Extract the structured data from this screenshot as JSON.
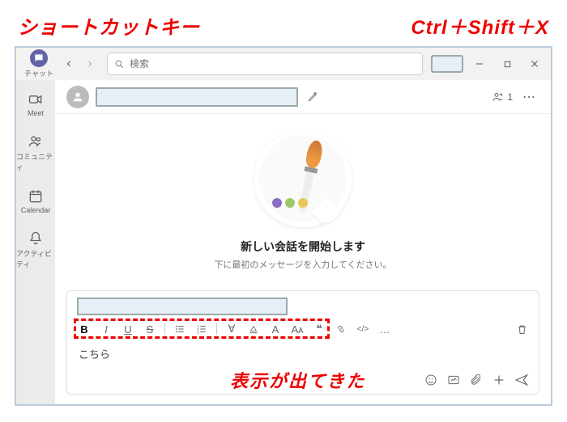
{
  "annotations": {
    "top_left": "ショートカットキー",
    "top_right": "Ctrl＋Shift＋X",
    "middle": "表示が出てきた"
  },
  "titlebar": {
    "app_label": "チャット",
    "search_placeholder": "検索"
  },
  "sidebar": {
    "items": [
      {
        "key": "meet",
        "label": "Meet"
      },
      {
        "key": "community",
        "label": "コミュニティ"
      },
      {
        "key": "calendar",
        "label": "Calendar"
      },
      {
        "key": "activity",
        "label": "アクティビティ"
      }
    ]
  },
  "header": {
    "people_count": "1"
  },
  "empty_state": {
    "title": "新しい会話を開始します",
    "subtitle": "下に最初のメッセージを入力してください。"
  },
  "compose": {
    "body_text": "こちら"
  },
  "toolbar": {
    "bold": "B",
    "italic": "I",
    "underline": "U",
    "strike": "S",
    "quote": "❝",
    "link": "🔗",
    "code": "</>",
    "more": "…",
    "highlight": "▾",
    "fontcolor": "A",
    "fontsize": "Aᴀ",
    "clear": "∀",
    "trash": "🗑"
  },
  "footer": {
    "emoji": "☺",
    "gif": "▣",
    "attach": "📎",
    "plus": "＋",
    "send": "▷"
  }
}
